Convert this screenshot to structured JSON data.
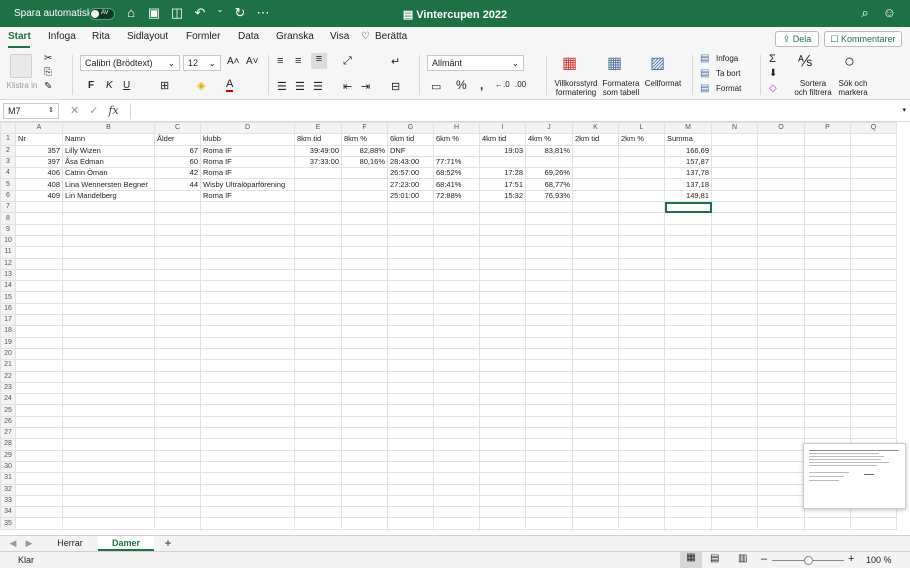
{
  "titlebar": {
    "autosave_label": "Spara automatiskt",
    "toggle_label": "AV",
    "doc_title": "Vintercupen 2022"
  },
  "tabs": [
    {
      "label": "Start",
      "active": true
    },
    {
      "label": "Infoga"
    },
    {
      "label": "Rita"
    },
    {
      "label": "Sidlayout"
    },
    {
      "label": "Formler"
    },
    {
      "label": "Data"
    },
    {
      "label": "Granska"
    },
    {
      "label": "Visa"
    },
    {
      "label": "Berätta"
    }
  ],
  "share_label": "Dela",
  "comments_label": "Kommentarer",
  "ribbon": {
    "paste_label": "Klistra in",
    "font_name": "Calibri (Brödtext)",
    "font_size": "12",
    "bold": "F",
    "italic": "K",
    "underline": "U",
    "number_format": "Allmänt",
    "conditional_label": "Villkorsstyrd\nformatering",
    "format_table_label": "Formatera\nsom tabell",
    "cell_format_label": "Cellformat",
    "insert_label": "Infoga",
    "delete_label": "Ta bort",
    "format_label": "Format",
    "sort_label": "Sortera\noch filtrera",
    "find_label": "Sök och\nmarkera"
  },
  "formula_bar": {
    "name_box": "M7",
    "fx": "fx",
    "value": ""
  },
  "sheet": {
    "columns": [
      "A",
      "B",
      "C",
      "D",
      "E",
      "F",
      "G",
      "H",
      "I",
      "J",
      "K",
      "L",
      "M",
      "N",
      "O",
      "P",
      "Q"
    ],
    "rows": [
      [
        "Nr",
        "Namn",
        "Ålder",
        "klubb",
        "8km tid",
        "8km %",
        "6km tid",
        "6km %",
        "4km tid",
        "4km %",
        "2km tid",
        "2km %",
        "Summa",
        "",
        "",
        "",
        ""
      ],
      [
        "357",
        "Lilly Wizen",
        "67",
        "Roma IF",
        "39:49:00",
        "82,88%",
        "DNF",
        "",
        "19:03",
        "83,81%",
        "",
        "",
        "166,69",
        "",
        "",
        "",
        ""
      ],
      [
        "397",
        "Åsa Edman",
        "60",
        "Roma IF",
        "37:33:00",
        "80,16%",
        "28:43:00",
        "77:71%",
        "",
        "",
        "",
        "",
        "157,87",
        "",
        "",
        "",
        ""
      ],
      [
        "406",
        "Catrin Öman",
        "42",
        "Roma IF",
        "",
        "",
        "26:57:00",
        "68:52%",
        "17:28",
        "69,26%",
        "",
        "",
        "137,78",
        "",
        "",
        "",
        ""
      ],
      [
        "408",
        "Lina Wennersten Begner",
        "44",
        "Wisby Ultralöparförening",
        "",
        "",
        "27:23:00",
        "68:41%",
        "17:51",
        "68,77%",
        "",
        "",
        "137,18",
        "",
        "",
        "",
        ""
      ],
      [
        "409",
        "Lin Mandelberg",
        "",
        "Roma IF",
        "",
        "",
        "25:01:00",
        "72:88%",
        "15:32",
        "76,93%",
        "",
        "",
        "149,81",
        "",
        "",
        "",
        ""
      ]
    ],
    "total_rows": 35,
    "selected_cell": "M7"
  },
  "sheet_tabs": [
    {
      "label": "Herrar"
    },
    {
      "label": "Damer",
      "active": true
    }
  ],
  "add_sheet": "+",
  "status": {
    "ready": "Klar",
    "zoom": "100 %"
  },
  "colors": {
    "accent": "#1e7145"
  }
}
